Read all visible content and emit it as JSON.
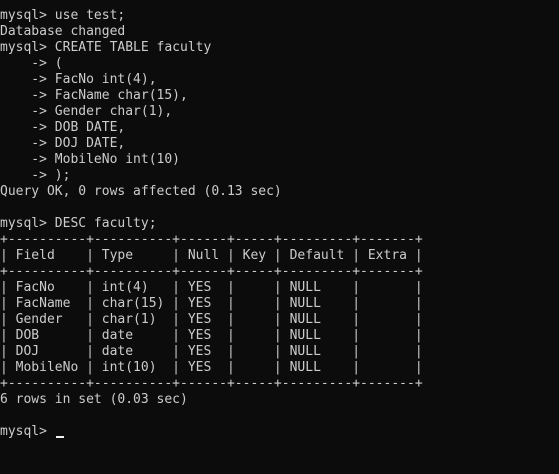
{
  "terminal": {
    "lines": [
      "mysql> use test;",
      "Database changed",
      "mysql> CREATE TABLE faculty",
      "    -> (",
      "    -> FacNo int(4),",
      "    -> FacName char(15),",
      "    -> Gender char(1),",
      "    -> DOB DATE,",
      "    -> DOJ DATE,",
      "    -> MobileNo int(10)",
      "    -> );",
      "Query OK, 0 rows affected (0.13 sec)",
      "",
      "mysql> DESC faculty;",
      "+----------+----------+------+-----+---------+-------+",
      "| Field    | Type     | Null | Key | Default | Extra |",
      "+----------+----------+------+-----+---------+-------+",
      "| FacNo    | int(4)   | YES  |     | NULL    |       |",
      "| FacName  | char(15) | YES  |     | NULL    |       |",
      "| Gender   | char(1)  | YES  |     | NULL    |       |",
      "| DOB      | date     | YES  |     | NULL    |       |",
      "| DOJ      | date     | YES  |     | NULL    |       |",
      "| MobileNo | int(10)  | YES  |     | NULL    |       |",
      "+----------+----------+------+-----+---------+-------+",
      "6 rows in set (0.03 sec)",
      "",
      "mysql> "
    ]
  }
}
